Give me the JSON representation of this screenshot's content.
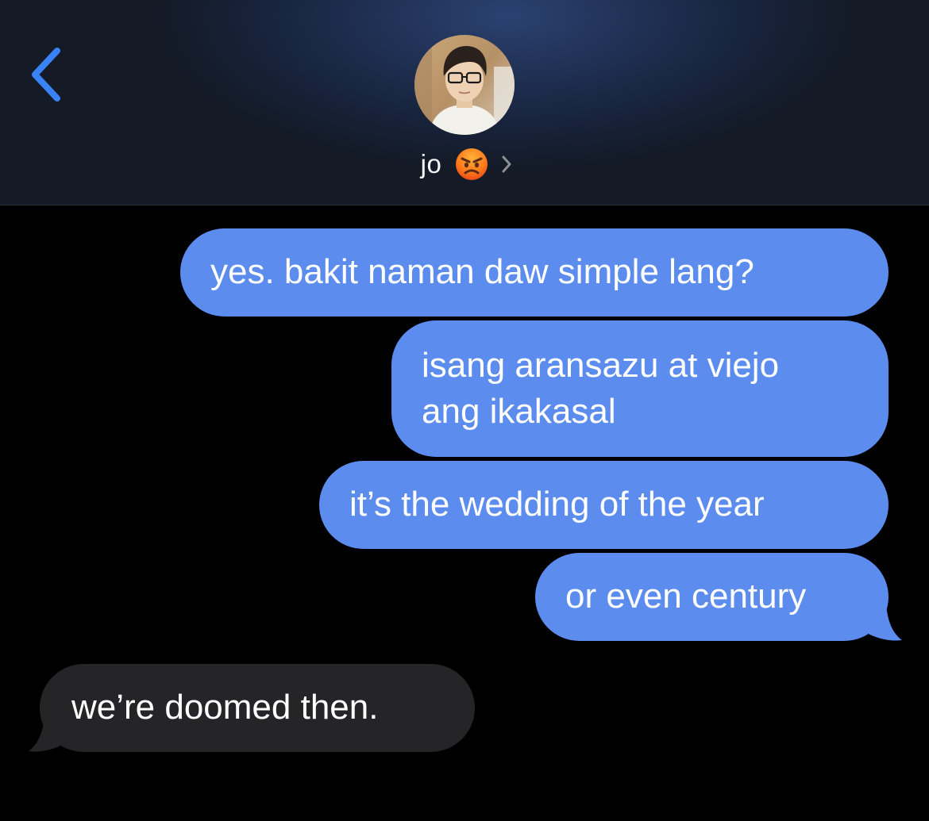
{
  "header": {
    "back_icon": "chevron-left-icon",
    "contact_name": "jo",
    "status_emoji": "angry-face-emoji",
    "chevron_icon": "chevron-right-icon"
  },
  "colors": {
    "accent": "#3a82f7",
    "sent_bubble": "#5b8cee",
    "received_bubble": "#252528",
    "background": "#000000"
  },
  "messages": [
    {
      "direction": "sent",
      "lines": [
        "yes. bakit naman daw simple lang?"
      ]
    },
    {
      "direction": "sent",
      "lines": [
        "isang aransazu at viejo",
        "ang ikakasal"
      ]
    },
    {
      "direction": "sent",
      "lines": [
        "it’s the wedding of the year"
      ]
    },
    {
      "direction": "sent",
      "lines": [
        "or even century"
      ]
    },
    {
      "direction": "received",
      "lines": [
        "we’re doomed then."
      ]
    }
  ]
}
